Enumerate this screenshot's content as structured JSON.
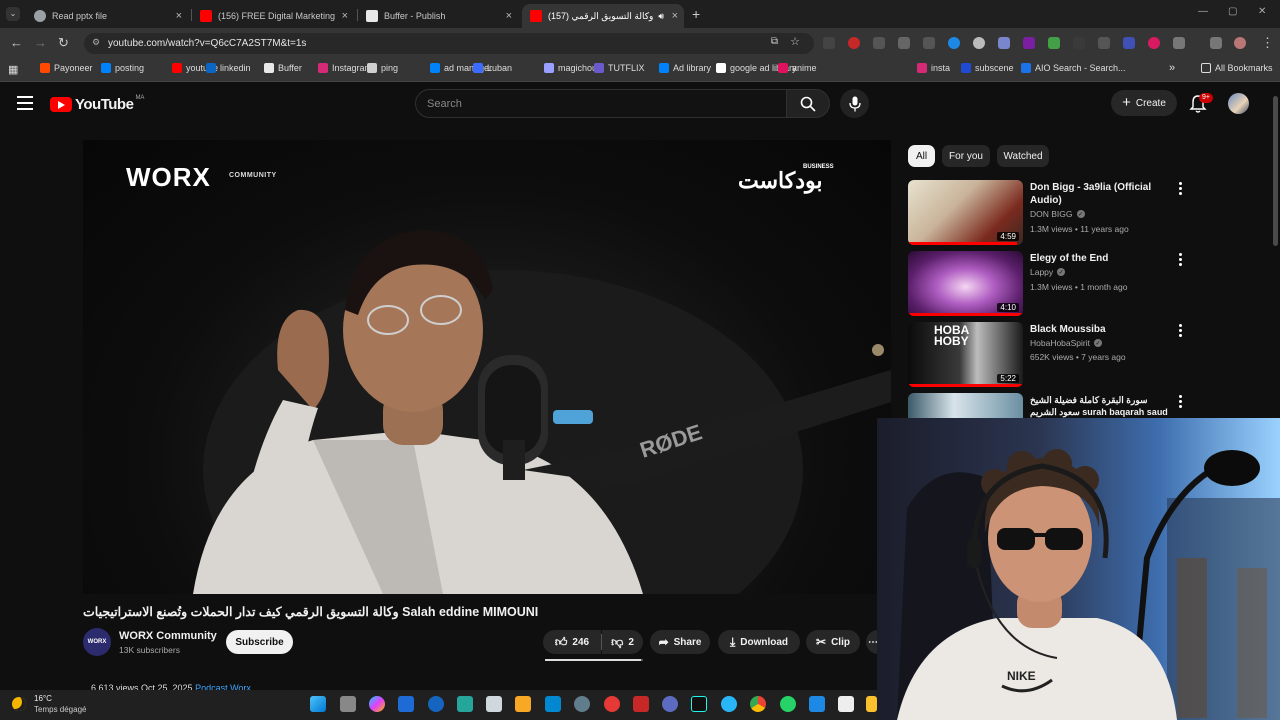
{
  "browser": {
    "tabs": [
      {
        "title": "Read pptx file",
        "color": "#9aa0a6"
      },
      {
        "title": "(156) FREE Digital Marketing Co",
        "color": "#ff0000"
      },
      {
        "title": "Buffer - Publish",
        "color": "#e8e8e8"
      },
      {
        "title": "(157) وكالة التسويق الرقمي",
        "color": "#ff0000"
      }
    ],
    "new_tab": "+",
    "url": "youtube.com/watch?v=Q6cC7A2ST7M&t=1s",
    "bookmarks": [
      {
        "label": "Payoneer",
        "color": "#ff4800"
      },
      {
        "label": "posting",
        "color": "#0082fb"
      },
      {
        "label": "youtube",
        "color": "#ff0000"
      },
      {
        "label": "linkedin",
        "color": "#0a66c2"
      },
      {
        "label": "Buffer",
        "color": "#e8e8e8"
      },
      {
        "label": "Instagram",
        "color": "#d62976"
      },
      {
        "label": "ping",
        "color": "#cfcfcf"
      },
      {
        "label": "ad manager",
        "color": "#0082fb"
      },
      {
        "label": "Luban",
        "color": "#3c6cff"
      },
      {
        "label": "magichour",
        "color": "#9aa0ff"
      },
      {
        "label": "TUTFLIX",
        "color": "#6a5acd"
      },
      {
        "label": "Ad library",
        "color": "#0082fb"
      },
      {
        "label": "google ad library",
        "color": "#ffffff"
      },
      {
        "label": "anime",
        "color": "#e0115f"
      },
      {
        "label": "insta",
        "color": "#d62976"
      },
      {
        "label": "subscene",
        "color": "#1e4bd1"
      },
      {
        "label": "AIO Search - Search...",
        "color": "#1a73e8"
      }
    ],
    "all_bookmarks": "All Bookmarks"
  },
  "youtube": {
    "country_code": "MA",
    "logo_text": "YouTube",
    "search_placeholder": "Search",
    "create_label": "Create",
    "notifications_badge": "9+"
  },
  "video": {
    "overlay_brand": "WORX",
    "overlay_brand_sub": "COMMUNITY",
    "overlay_podcast": "بودكاست",
    "overlay_podcast_sub": "BUSINESS",
    "title": "وكالة التسويق الرقمي كيف تدار الحملات وتُصنع الاستراتيجيات Salah eddine MIMOUNI",
    "channel_avatar_text": "WORX",
    "channel": "WORX Community",
    "subscribers": "13K subscribers",
    "subscribe_label": "Subscribe",
    "likes": "246",
    "dislikes": "2",
    "share_label": "Share",
    "download_label": "Download",
    "clip_label": "Clip",
    "views_line": "6,613 views  Oct 25, 2025",
    "views_tag": "Podcast Worx"
  },
  "chips": [
    "All",
    "For you",
    "Watched"
  ],
  "recommendations": [
    {
      "title": "Don Bigg - 3a9lia (Official Audio)",
      "channel": "DON BIGG",
      "meta": "1.3M views • 11 years ago",
      "duration": "4:59",
      "progress": 0.95
    },
    {
      "title": "Elegy of the End",
      "channel": "Lappy",
      "meta": "1.3M views • 1 month ago",
      "duration": "4:10",
      "progress": 1.0
    },
    {
      "title": "Black Moussiba",
      "channel": "HobaHobaSpirit",
      "meta": "652K views • 7 years ago",
      "duration": "5:22",
      "progress": 1.0
    },
    {
      "title": "سورة البقرة كاملة فضيلة الشيخ سعود الشريم surah baqarah saud shuraim",
      "channel": "",
      "meta": "",
      "duration": "",
      "progress": 0
    }
  ],
  "taskbar": {
    "temperature": "16°C",
    "weather": "Temps dégagé"
  },
  "colors": {
    "yt_red": "#ff0000",
    "background": "#0f0f0f",
    "link_blue": "#3ea6ff"
  }
}
